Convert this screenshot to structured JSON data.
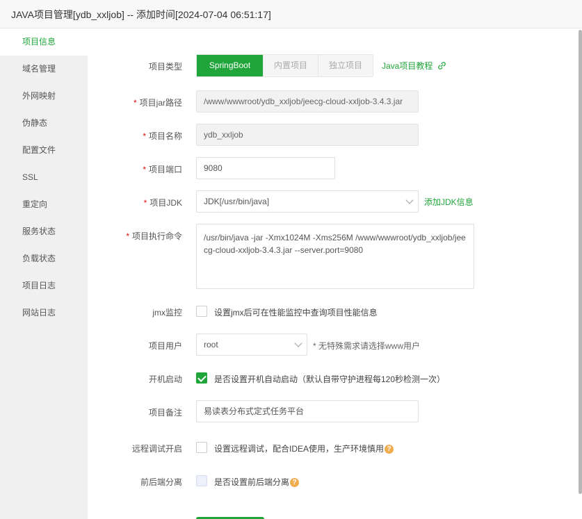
{
  "window": {
    "title": "JAVA项目管理[ydb_xxljob] -- 添加时间[2024-07-04 06:51:17]"
  },
  "sidebar": {
    "items": [
      {
        "label": "项目信息",
        "active": true
      },
      {
        "label": "域名管理"
      },
      {
        "label": "外网映射"
      },
      {
        "label": "伪静态"
      },
      {
        "label": "配置文件"
      },
      {
        "label": "SSL"
      },
      {
        "label": "重定向"
      },
      {
        "label": "服务状态"
      },
      {
        "label": "负载状态"
      },
      {
        "label": "项目日志"
      },
      {
        "label": "网站日志"
      }
    ]
  },
  "form": {
    "project_type": {
      "label": "项目类型",
      "options": [
        "SpringBoot",
        "内置项目",
        "独立项目"
      ],
      "selected": "SpringBoot",
      "tutorial_link": "Java项目教程"
    },
    "jar_path": {
      "required": "*",
      "label": "项目jar路径",
      "value": "/www/wwwroot/ydb_xxljob/jeecg-cloud-xxljob-3.4.3.jar"
    },
    "project_name": {
      "required": "*",
      "label": "项目名称",
      "value": "ydb_xxljob"
    },
    "project_port": {
      "required": "*",
      "label": "项目端口",
      "value": "9080"
    },
    "project_jdk": {
      "required": "*",
      "label": "项目JDK",
      "value": "JDK[/usr/bin/java]",
      "add_link": "添加JDK信息"
    },
    "exec_command": {
      "required": "*",
      "label": "项目执行命令",
      "value": "/usr/bin/java  -jar -Xmx1024M -Xms256M  /www/wwwroot/ydb_xxljob/jeecg-cloud-xxljob-3.4.3.jar --server.port=9080"
    },
    "jmx": {
      "label": "jmx监控",
      "checkbox_text": "设置jmx后可在性能监控中查询项目性能信息",
      "checked": false
    },
    "project_user": {
      "label": "项目用户",
      "value": "root",
      "hint": "* 无特殊需求请选择www用户"
    },
    "autostart": {
      "label": "开机启动",
      "checkbox_text": "是否设置开机自动启动（默认自带守护进程每120秒检测一次）",
      "checked": true
    },
    "remark": {
      "label": "项目备注",
      "value": "易读表分布式定式任务平台"
    },
    "remote_debug": {
      "label": "远程调试开启",
      "checkbox_text": "设置远程调试，配合IDEA使用，生产环境慎用",
      "checked": false
    },
    "separation": {
      "label": "前后端分离",
      "checkbox_text": "是否设置前后端分离",
      "checked": false
    }
  },
  "colors": {
    "accent": "#20a53a",
    "required": "#ef0808",
    "help": "#f0ad4e"
  },
  "icons": {
    "link": "link-icon",
    "help": "question-icon",
    "dropdown": "chevron-down-icon"
  }
}
